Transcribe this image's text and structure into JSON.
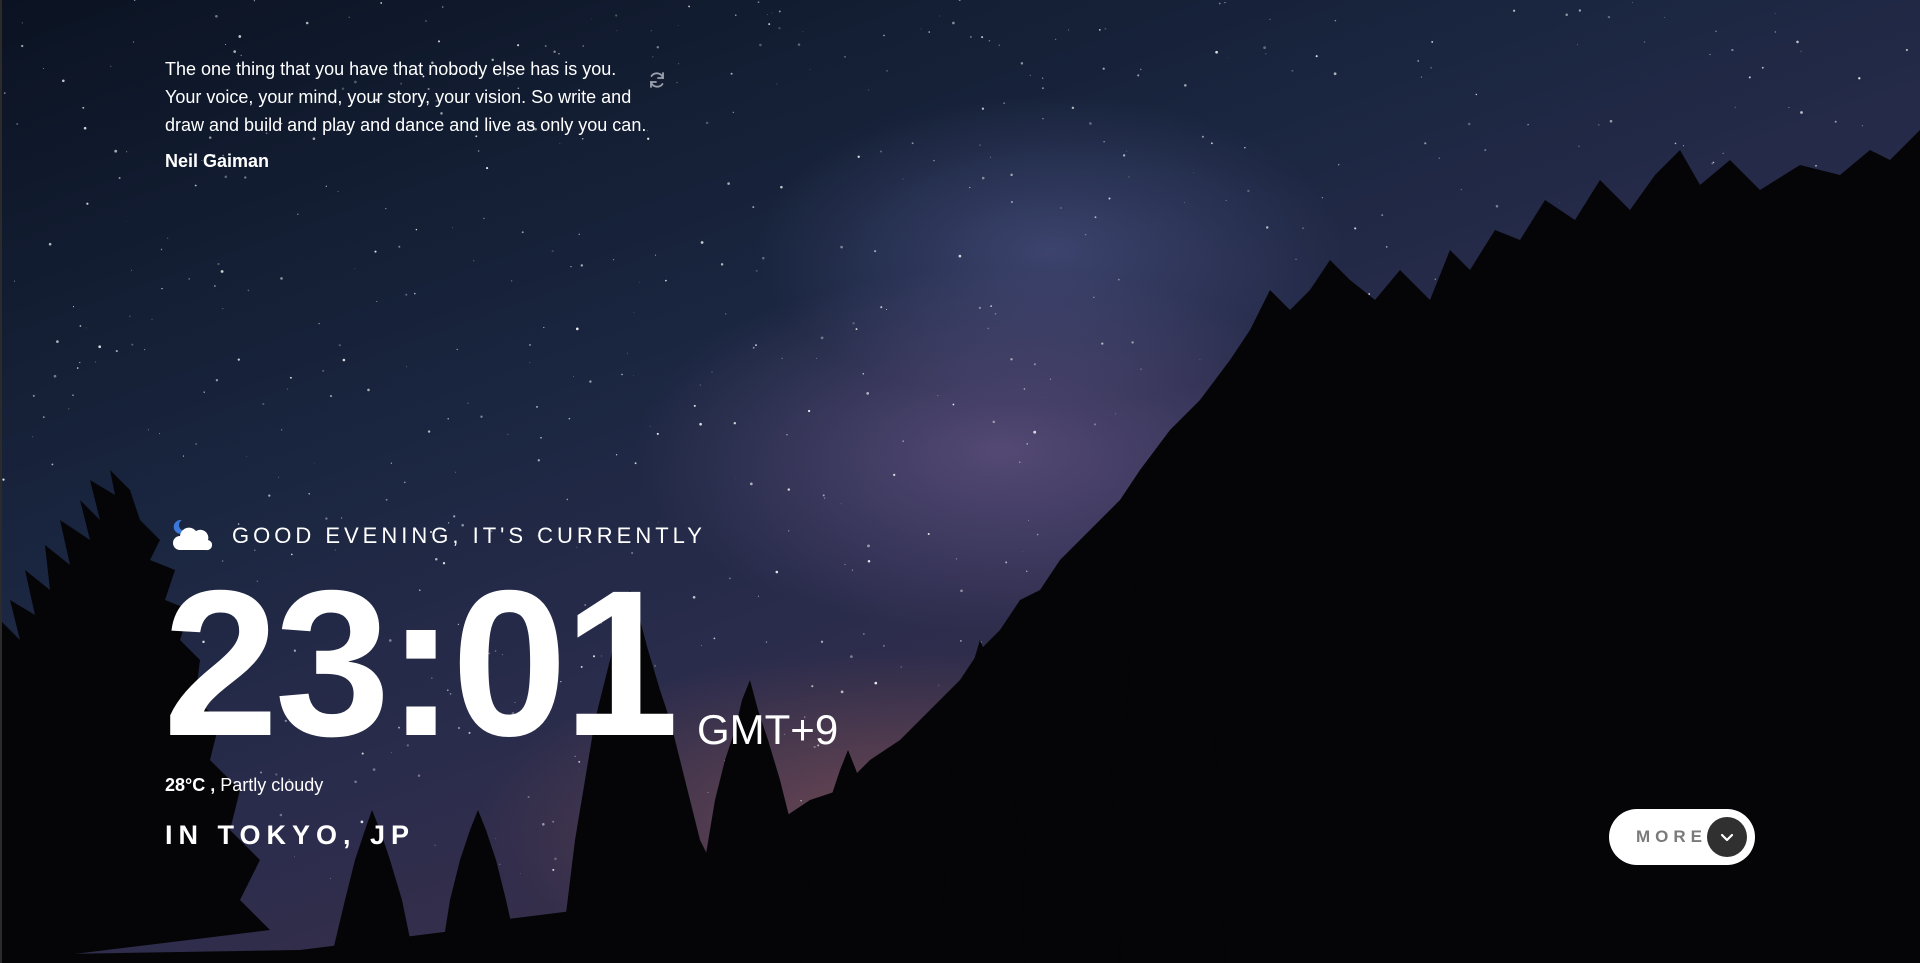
{
  "quote": {
    "text": "The one thing that you have that nobody else has is you. Your voice, your mind, your story, your vision. So write and draw and build and play and dance and live as only you can.",
    "author": "Neil Gaiman",
    "refresh_icon": "refresh-icon"
  },
  "greeting": {
    "icon": "moon-cloud-icon",
    "text": "GOOD EVENING, IT'S CURRENTLY"
  },
  "clock": {
    "time": "23:01",
    "timezone": "GMT+9"
  },
  "weather": {
    "temperature": "28°C ,",
    "condition": "Partly cloudy"
  },
  "location": {
    "text": "IN TOKYO, JP"
  },
  "more_button": {
    "label": "MORE",
    "icon": "chevron-down-icon"
  },
  "colors": {
    "text": "#ffffff",
    "button_bg": "#ffffff",
    "button_label": "#7a7a7a",
    "button_circle": "#303030"
  }
}
